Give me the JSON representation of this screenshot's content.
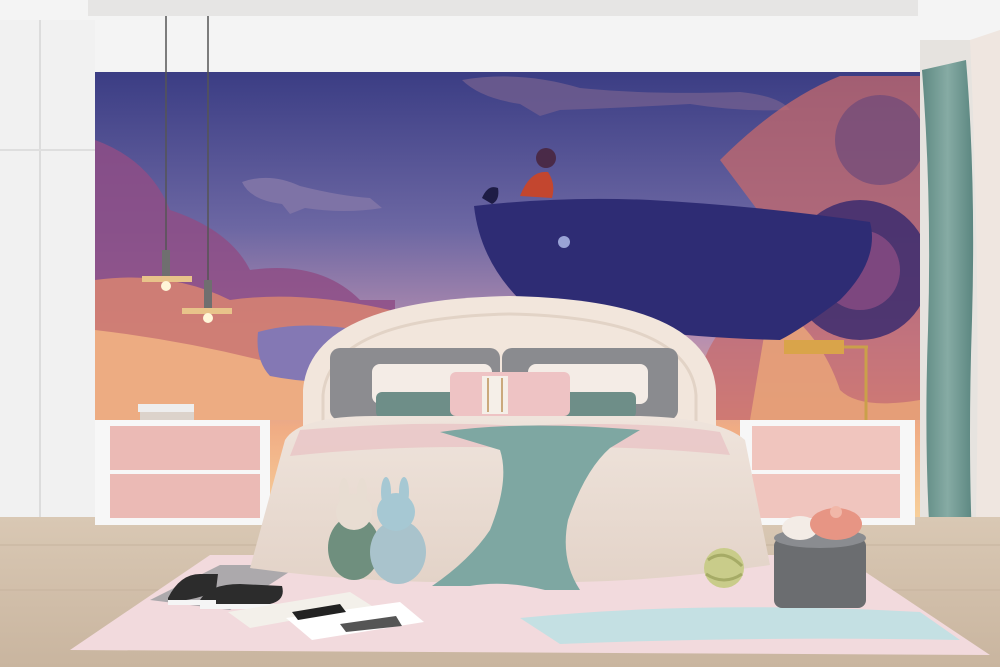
{
  "scene": {
    "kind": "photo",
    "subject": "kids-bedroom-interior",
    "palette": {
      "sky_top": "#3d3f86",
      "sky_mid": "#7a6a9f",
      "sunset": "#f0a978",
      "cloud_purple": "#8b4c86",
      "whale_dark": "#2b2a70",
      "wall": "#f2f2f2",
      "floor": "#d8c9b7",
      "rug": "#f3d9de",
      "headboard": "#f1e5da",
      "nightstand": "#e9b8b5",
      "throw_teal": "#7aa8a4",
      "curtain": "#6f9a92"
    }
  }
}
